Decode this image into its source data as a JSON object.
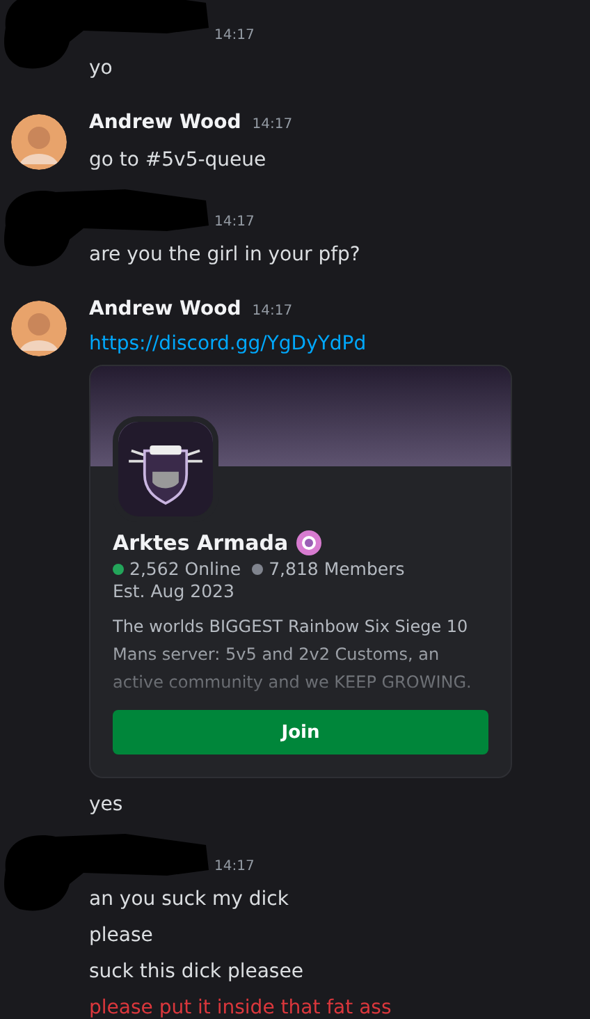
{
  "messages": [
    {
      "redacted": true,
      "time": "14:17",
      "items": [
        {
          "kind": "text",
          "text": "yo",
          "failed": false
        }
      ]
    },
    {
      "redacted": false,
      "author": "Andrew Wood",
      "time": "14:17",
      "items": [
        {
          "kind": "text",
          "text": "go to #5v5-queue",
          "failed": false
        }
      ]
    },
    {
      "redacted": true,
      "time": "14:17",
      "items": [
        {
          "kind": "text",
          "text": "are you the girl in your pfp?",
          "failed": false
        }
      ]
    },
    {
      "redacted": false,
      "author": "Andrew Wood",
      "time": "14:17",
      "items": [
        {
          "kind": "link",
          "text": "https://discord.gg/YgDyYdPd"
        },
        {
          "kind": "invite",
          "name": "Arktes Armada",
          "online": "2,562 Online",
          "members": "7,818 Members",
          "established": "Est. Aug 2023",
          "description": "The worlds BIGGEST Rainbow Six Siege 10 Mans server: 5v5 and 2v2 Customs, an active community and we KEEP GROWING.",
          "button": "Join"
        },
        {
          "kind": "text",
          "text": "yes",
          "failed": false
        }
      ]
    },
    {
      "redacted": true,
      "time": "14:17",
      "items": [
        {
          "kind": "text",
          "text": "an you suck my dick",
          "failed": false
        },
        {
          "kind": "text",
          "text": "please",
          "failed": false
        },
        {
          "kind": "text",
          "text": "suck this dick pleasee",
          "failed": false
        },
        {
          "kind": "text",
          "text": "please put it inside that fat ass",
          "failed": true
        }
      ]
    }
  ]
}
